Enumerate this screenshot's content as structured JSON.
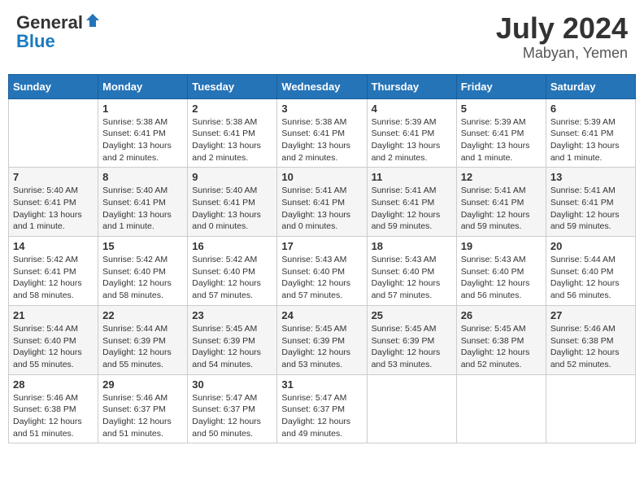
{
  "header": {
    "logo_general": "General",
    "logo_blue": "Blue",
    "title": "July 2024",
    "location": "Mabyan, Yemen"
  },
  "days_of_week": [
    "Sunday",
    "Monday",
    "Tuesday",
    "Wednesday",
    "Thursday",
    "Friday",
    "Saturday"
  ],
  "weeks": [
    [
      {
        "day": "",
        "sunrise": "",
        "sunset": "",
        "daylight": ""
      },
      {
        "day": "1",
        "sunrise": "Sunrise: 5:38 AM",
        "sunset": "Sunset: 6:41 PM",
        "daylight": "Daylight: 13 hours and 2 minutes."
      },
      {
        "day": "2",
        "sunrise": "Sunrise: 5:38 AM",
        "sunset": "Sunset: 6:41 PM",
        "daylight": "Daylight: 13 hours and 2 minutes."
      },
      {
        "day": "3",
        "sunrise": "Sunrise: 5:38 AM",
        "sunset": "Sunset: 6:41 PM",
        "daylight": "Daylight: 13 hours and 2 minutes."
      },
      {
        "day": "4",
        "sunrise": "Sunrise: 5:39 AM",
        "sunset": "Sunset: 6:41 PM",
        "daylight": "Daylight: 13 hours and 2 minutes."
      },
      {
        "day": "5",
        "sunrise": "Sunrise: 5:39 AM",
        "sunset": "Sunset: 6:41 PM",
        "daylight": "Daylight: 13 hours and 1 minute."
      },
      {
        "day": "6",
        "sunrise": "Sunrise: 5:39 AM",
        "sunset": "Sunset: 6:41 PM",
        "daylight": "Daylight: 13 hours and 1 minute."
      }
    ],
    [
      {
        "day": "7",
        "sunrise": "Sunrise: 5:40 AM",
        "sunset": "Sunset: 6:41 PM",
        "daylight": "Daylight: 13 hours and 1 minute."
      },
      {
        "day": "8",
        "sunrise": "Sunrise: 5:40 AM",
        "sunset": "Sunset: 6:41 PM",
        "daylight": "Daylight: 13 hours and 1 minute."
      },
      {
        "day": "9",
        "sunrise": "Sunrise: 5:40 AM",
        "sunset": "Sunset: 6:41 PM",
        "daylight": "Daylight: 13 hours and 0 minutes."
      },
      {
        "day": "10",
        "sunrise": "Sunrise: 5:41 AM",
        "sunset": "Sunset: 6:41 PM",
        "daylight": "Daylight: 13 hours and 0 minutes."
      },
      {
        "day": "11",
        "sunrise": "Sunrise: 5:41 AM",
        "sunset": "Sunset: 6:41 PM",
        "daylight": "Daylight: 12 hours and 59 minutes."
      },
      {
        "day": "12",
        "sunrise": "Sunrise: 5:41 AM",
        "sunset": "Sunset: 6:41 PM",
        "daylight": "Daylight: 12 hours and 59 minutes."
      },
      {
        "day": "13",
        "sunrise": "Sunrise: 5:41 AM",
        "sunset": "Sunset: 6:41 PM",
        "daylight": "Daylight: 12 hours and 59 minutes."
      }
    ],
    [
      {
        "day": "14",
        "sunrise": "Sunrise: 5:42 AM",
        "sunset": "Sunset: 6:41 PM",
        "daylight": "Daylight: 12 hours and 58 minutes."
      },
      {
        "day": "15",
        "sunrise": "Sunrise: 5:42 AM",
        "sunset": "Sunset: 6:40 PM",
        "daylight": "Daylight: 12 hours and 58 minutes."
      },
      {
        "day": "16",
        "sunrise": "Sunrise: 5:42 AM",
        "sunset": "Sunset: 6:40 PM",
        "daylight": "Daylight: 12 hours and 57 minutes."
      },
      {
        "day": "17",
        "sunrise": "Sunrise: 5:43 AM",
        "sunset": "Sunset: 6:40 PM",
        "daylight": "Daylight: 12 hours and 57 minutes."
      },
      {
        "day": "18",
        "sunrise": "Sunrise: 5:43 AM",
        "sunset": "Sunset: 6:40 PM",
        "daylight": "Daylight: 12 hours and 57 minutes."
      },
      {
        "day": "19",
        "sunrise": "Sunrise: 5:43 AM",
        "sunset": "Sunset: 6:40 PM",
        "daylight": "Daylight: 12 hours and 56 minutes."
      },
      {
        "day": "20",
        "sunrise": "Sunrise: 5:44 AM",
        "sunset": "Sunset: 6:40 PM",
        "daylight": "Daylight: 12 hours and 56 minutes."
      }
    ],
    [
      {
        "day": "21",
        "sunrise": "Sunrise: 5:44 AM",
        "sunset": "Sunset: 6:40 PM",
        "daylight": "Daylight: 12 hours and 55 minutes."
      },
      {
        "day": "22",
        "sunrise": "Sunrise: 5:44 AM",
        "sunset": "Sunset: 6:39 PM",
        "daylight": "Daylight: 12 hours and 55 minutes."
      },
      {
        "day": "23",
        "sunrise": "Sunrise: 5:45 AM",
        "sunset": "Sunset: 6:39 PM",
        "daylight": "Daylight: 12 hours and 54 minutes."
      },
      {
        "day": "24",
        "sunrise": "Sunrise: 5:45 AM",
        "sunset": "Sunset: 6:39 PM",
        "daylight": "Daylight: 12 hours and 53 minutes."
      },
      {
        "day": "25",
        "sunrise": "Sunrise: 5:45 AM",
        "sunset": "Sunset: 6:39 PM",
        "daylight": "Daylight: 12 hours and 53 minutes."
      },
      {
        "day": "26",
        "sunrise": "Sunrise: 5:45 AM",
        "sunset": "Sunset: 6:38 PM",
        "daylight": "Daylight: 12 hours and 52 minutes."
      },
      {
        "day": "27",
        "sunrise": "Sunrise: 5:46 AM",
        "sunset": "Sunset: 6:38 PM",
        "daylight": "Daylight: 12 hours and 52 minutes."
      }
    ],
    [
      {
        "day": "28",
        "sunrise": "Sunrise: 5:46 AM",
        "sunset": "Sunset: 6:38 PM",
        "daylight": "Daylight: 12 hours and 51 minutes."
      },
      {
        "day": "29",
        "sunrise": "Sunrise: 5:46 AM",
        "sunset": "Sunset: 6:37 PM",
        "daylight": "Daylight: 12 hours and 51 minutes."
      },
      {
        "day": "30",
        "sunrise": "Sunrise: 5:47 AM",
        "sunset": "Sunset: 6:37 PM",
        "daylight": "Daylight: 12 hours and 50 minutes."
      },
      {
        "day": "31",
        "sunrise": "Sunrise: 5:47 AM",
        "sunset": "Sunset: 6:37 PM",
        "daylight": "Daylight: 12 hours and 49 minutes."
      },
      {
        "day": "",
        "sunrise": "",
        "sunset": "",
        "daylight": ""
      },
      {
        "day": "",
        "sunrise": "",
        "sunset": "",
        "daylight": ""
      },
      {
        "day": "",
        "sunrise": "",
        "sunset": "",
        "daylight": ""
      }
    ]
  ]
}
